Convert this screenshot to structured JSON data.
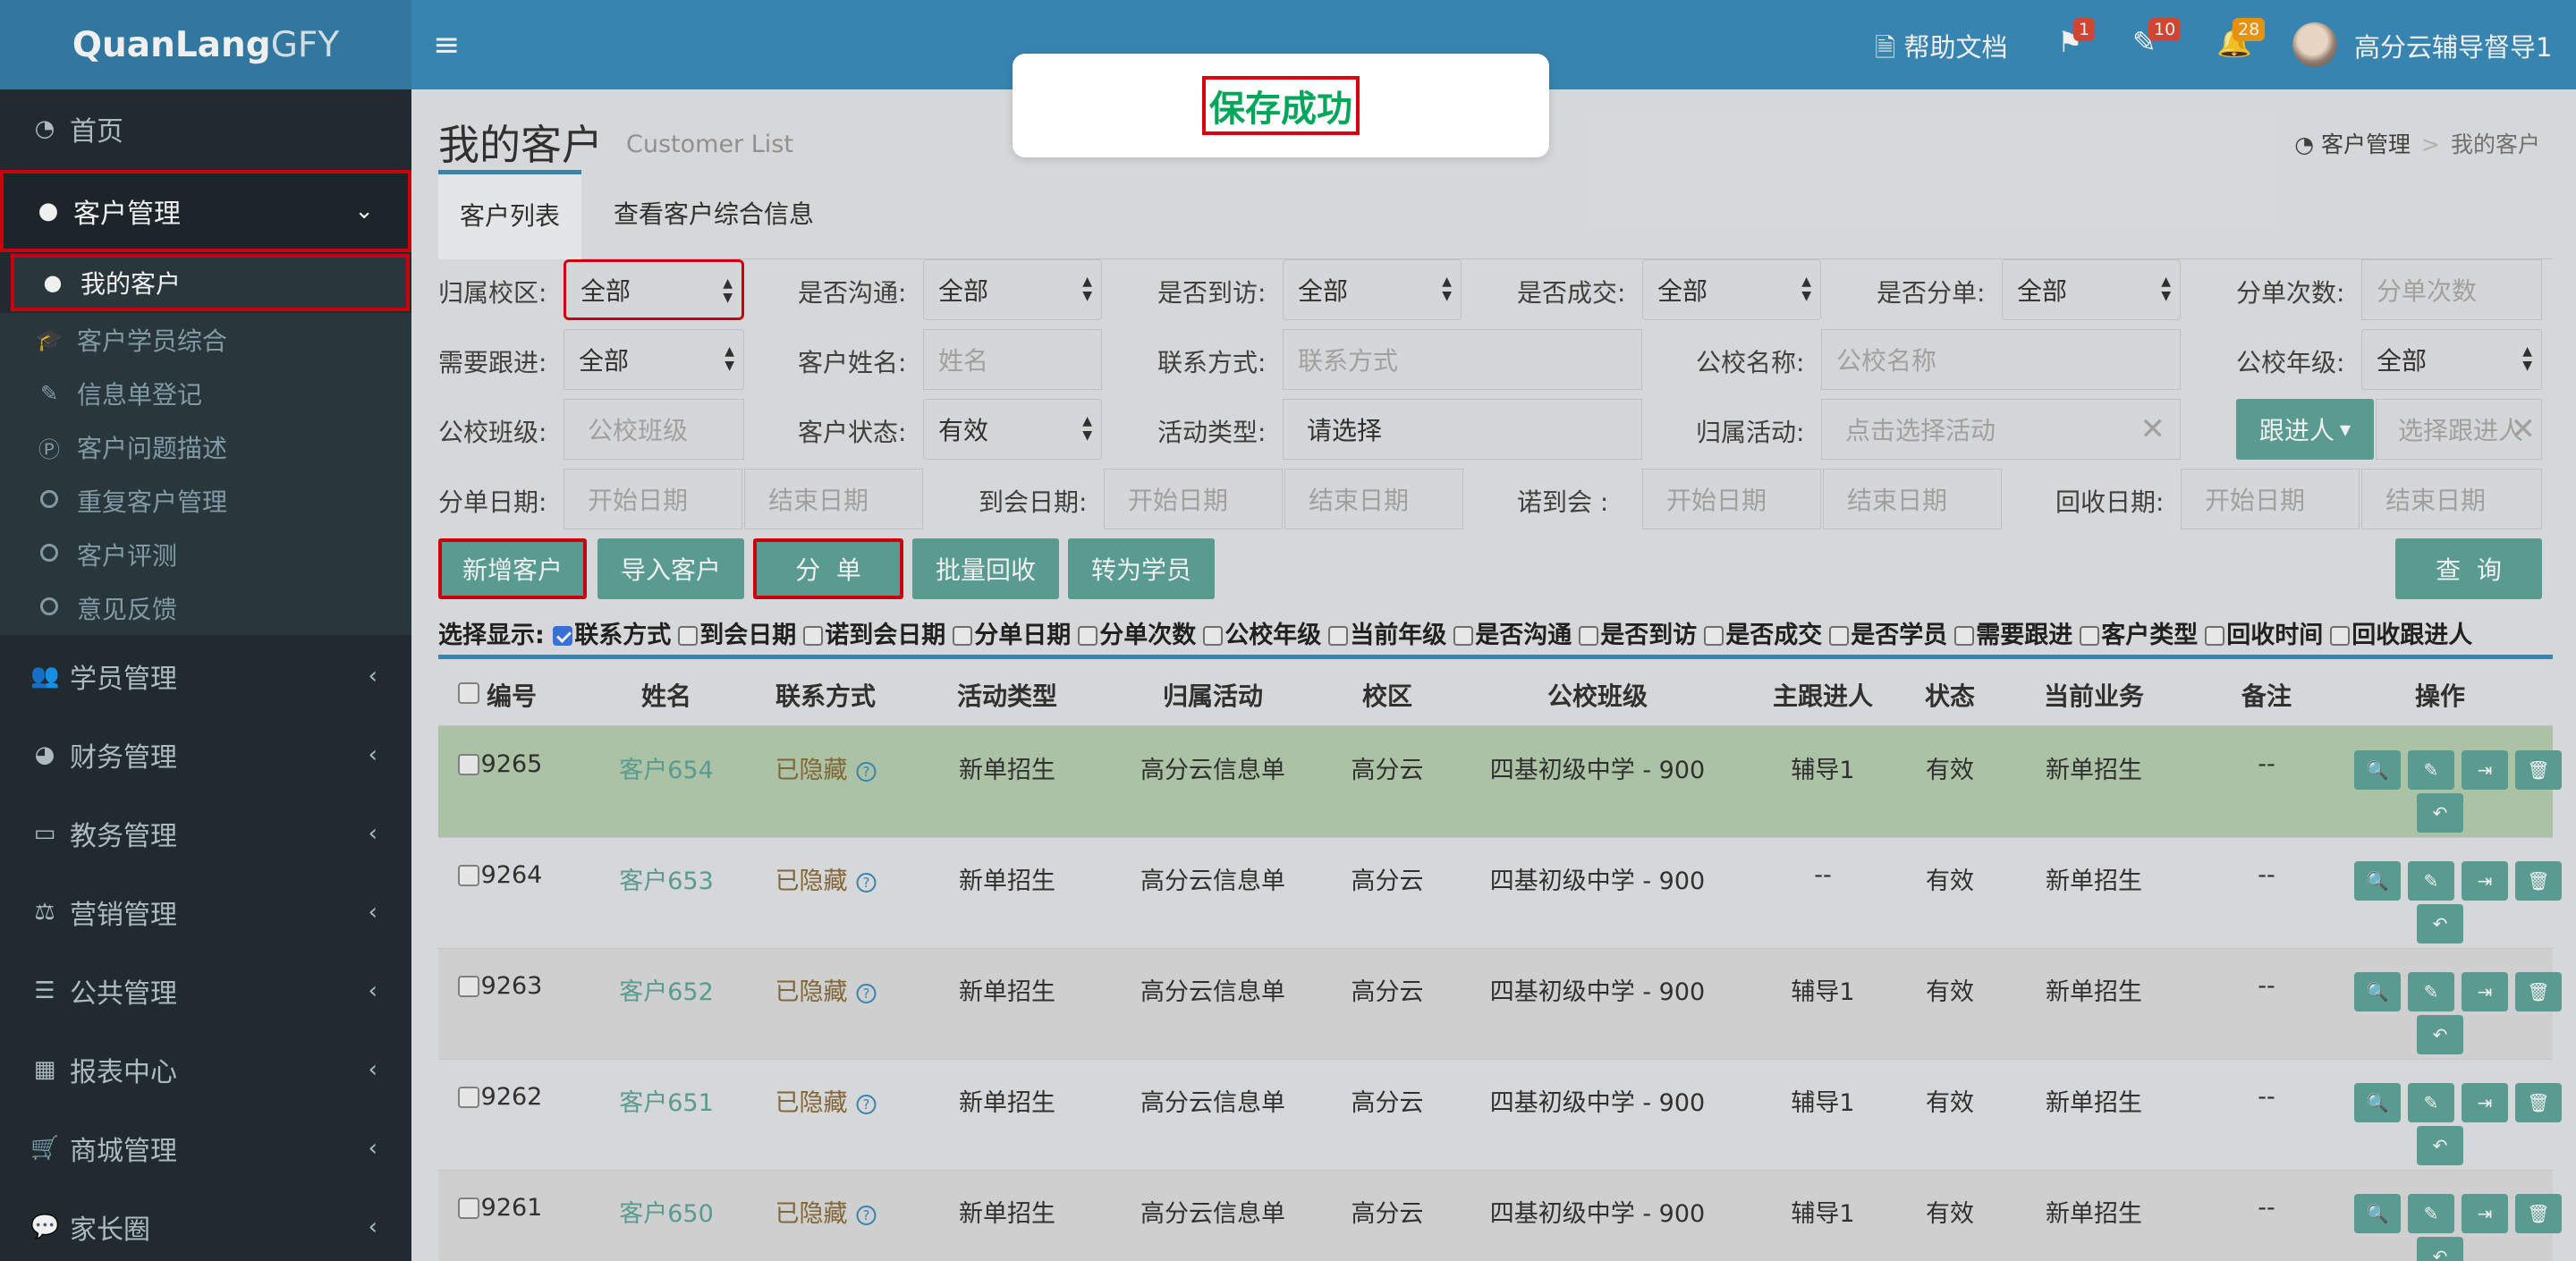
{
  "app": {
    "logo_main": "QuanLang",
    "logo_thin": "GFY"
  },
  "sidebar": {
    "items": [
      {
        "label": "首页",
        "icon": "dashboard-icon"
      },
      {
        "label": "客户管理",
        "icon": "user-icon"
      },
      {
        "label": "学员管理",
        "icon": "users-icon"
      },
      {
        "label": "财务管理",
        "icon": "pie-chart-icon"
      },
      {
        "label": "教务管理",
        "icon": "laptop-icon"
      },
      {
        "label": "营销管理",
        "icon": "balance-scale-icon"
      },
      {
        "label": "公共管理",
        "icon": "list-icon"
      },
      {
        "label": "报表中心",
        "icon": "table-icon"
      },
      {
        "label": "商城管理",
        "icon": "cart-icon"
      },
      {
        "label": "家长圈",
        "icon": "comments-icon"
      }
    ],
    "sub_items": [
      {
        "label": "我的客户",
        "icon": "user-icon"
      },
      {
        "label": "客户学员综合",
        "icon": "graduation-cap-icon"
      },
      {
        "label": "信息单登记",
        "icon": "edit-icon"
      },
      {
        "label": "客户问题描述",
        "icon": "product-hunt-icon"
      },
      {
        "label": "重复客户管理",
        "icon": "circle-icon"
      },
      {
        "label": "客户评测",
        "icon": "circle-icon"
      },
      {
        "label": "意见反馈",
        "icon": "circle-icon"
      }
    ]
  },
  "topbar": {
    "help": "帮助文档",
    "flag_count": "1",
    "edit_count": "10",
    "bell_count": "28",
    "user": "高分云辅导督导1"
  },
  "page": {
    "title": "我的客户",
    "subtitle": "Customer List",
    "breadcrumb": [
      "客户管理",
      "我的客户"
    ]
  },
  "tabs": [
    "客户列表",
    "查看客户综合信息"
  ],
  "filters": {
    "campus_label": "归属校区:",
    "campus_value": "全部",
    "communicated_label": "是否沟通:",
    "communicated_value": "全部",
    "visited_label": "是否到访:",
    "visited_value": "全部",
    "deal_label": "是否成交:",
    "deal_value": "全部",
    "split_label": "是否分单:",
    "split_value": "全部",
    "split_times_label": "分单次数:",
    "split_times_ph": "分单次数",
    "followup_label": "需要跟进:",
    "followup_value": "全部",
    "name_label": "客户姓名:",
    "name_ph": "姓名",
    "contact_label": "联系方式:",
    "contact_ph": "联系方式",
    "school_label": "公校名称:",
    "school_ph": "公校名称",
    "grade_label": "公校年级:",
    "grade_value": "全部",
    "class_label": "公校班级:",
    "class_ph": "公校班级",
    "status_label": "客户状态:",
    "status_value": "有效",
    "activity_type_label": "活动类型:",
    "activity_type_value": "请选择",
    "activity_label": "归属活动:",
    "activity_ph": "点击选择活动",
    "follower_btn": "跟进人",
    "follower_ph": "选择跟进人",
    "split_date_label": "分单日期:",
    "arrive_date_label": "到会日期:",
    "promise_label": "诺到会  :",
    "recycle_date_label": "回收日期:",
    "start_ph": "开始日期",
    "end_ph": "结束日期"
  },
  "buttons": {
    "add": "新增客户",
    "import": "导入客户",
    "split": "分  单",
    "recycle": "批量回收",
    "to_student": "转为学员",
    "query": "查  询"
  },
  "display": {
    "label": "选择显示:",
    "options": [
      {
        "label": "联系方式",
        "checked": true
      },
      {
        "label": "到会日期",
        "checked": false
      },
      {
        "label": "诺到会日期",
        "checked": false
      },
      {
        "label": "分单日期",
        "checked": false
      },
      {
        "label": "分单次数",
        "checked": false
      },
      {
        "label": "公校年级",
        "checked": false
      },
      {
        "label": "当前年级",
        "checked": false
      },
      {
        "label": "是否沟通",
        "checked": false
      },
      {
        "label": "是否到访",
        "checked": false
      },
      {
        "label": "是否成交",
        "checked": false
      },
      {
        "label": "是否学员",
        "checked": false
      },
      {
        "label": "需要跟进",
        "checked": false
      },
      {
        "label": "客户类型",
        "checked": false
      },
      {
        "label": "回收时间",
        "checked": false
      },
      {
        "label": "回收跟进人",
        "checked": false
      }
    ]
  },
  "table": {
    "headers": [
      "编号",
      "姓名",
      "联系方式",
      "活动类型",
      "归属活动",
      "校区",
      "公校班级",
      "主跟进人",
      "状态",
      "当前业务",
      "备注",
      "操作"
    ],
    "rows": [
      {
        "id": "9265",
        "name": "客户654",
        "contact": "已隐藏",
        "type": "新单招生",
        "activity": "高分云信息单",
        "campus": "高分云",
        "class": "四基初级中学 - 900",
        "follower": "辅导1",
        "status": "有效",
        "business": "新单招生",
        "note": "--"
      },
      {
        "id": "9264",
        "name": "客户653",
        "contact": "已隐藏",
        "type": "新单招生",
        "activity": "高分云信息单",
        "campus": "高分云",
        "class": "四基初级中学 - 900",
        "follower": "--",
        "status": "有效",
        "business": "新单招生",
        "note": "--"
      },
      {
        "id": "9263",
        "name": "客户652",
        "contact": "已隐藏",
        "type": "新单招生",
        "activity": "高分云信息单",
        "campus": "高分云",
        "class": "四基初级中学 - 900",
        "follower": "辅导1",
        "status": "有效",
        "business": "新单招生",
        "note": "--"
      },
      {
        "id": "9262",
        "name": "客户651",
        "contact": "已隐藏",
        "type": "新单招生",
        "activity": "高分云信息单",
        "campus": "高分云",
        "class": "四基初级中学 - 900",
        "follower": "辅导1",
        "status": "有效",
        "business": "新单招生",
        "note": "--"
      },
      {
        "id": "9261",
        "name": "客户650",
        "contact": "已隐藏",
        "type": "新单招生",
        "activity": "高分云信息单",
        "campus": "高分云",
        "class": "四基初级中学 - 900",
        "follower": "辅导1",
        "status": "有效",
        "business": "新单招生",
        "note": "--"
      }
    ]
  },
  "toast": {
    "message": "保存成功"
  },
  "colors": {
    "header": "#3c8dbc",
    "sidebar": "#222d32",
    "button": "#5fa59a",
    "success": "#00a65a",
    "highlight": "#d9000d"
  }
}
